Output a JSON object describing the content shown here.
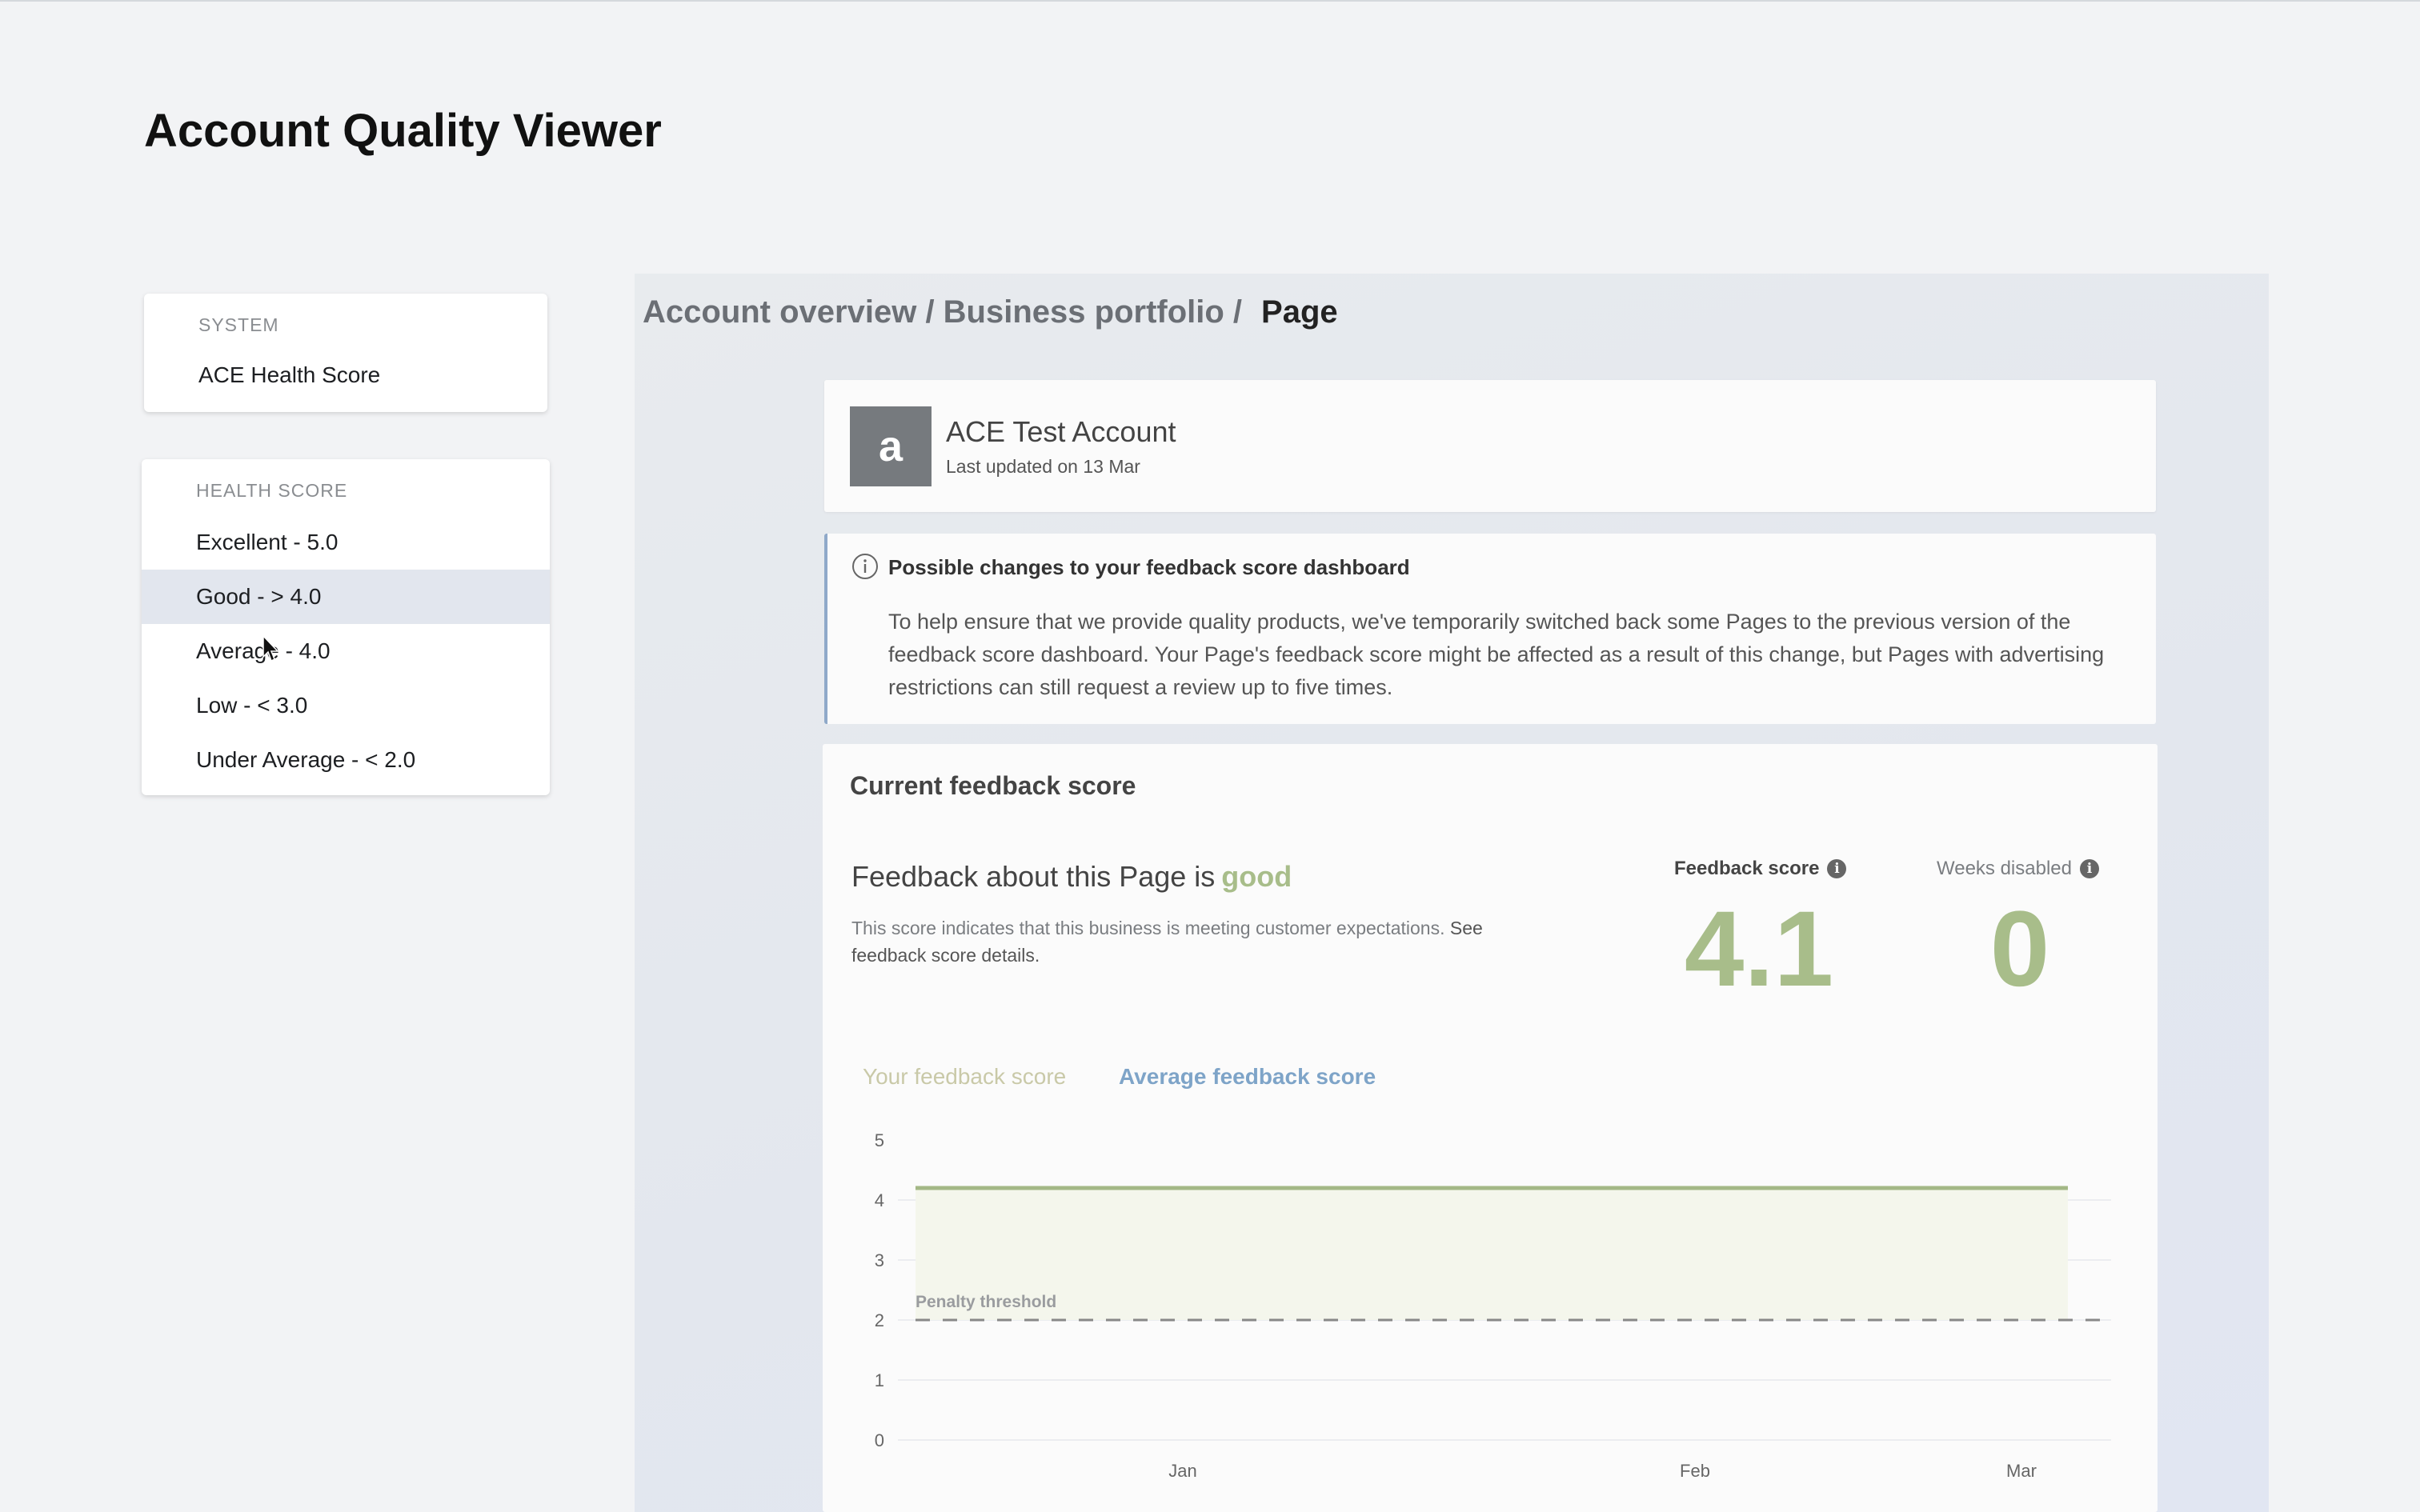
{
  "app": {
    "title": "Account Quality Viewer"
  },
  "system_card": {
    "header": "SYSTEM",
    "item": "ACE Health Score"
  },
  "health_score_card": {
    "header": "HEALTH SCORE",
    "items": [
      {
        "label": "Excellent - 5.0"
      },
      {
        "label": "Good - > 4.0",
        "selected": true
      },
      {
        "label": "Average - 4.0"
      },
      {
        "label": "Low - < 3.0"
      },
      {
        "label": "Under Average - < 2.0"
      }
    ]
  },
  "breadcrumb": {
    "path": "Account overview / Business portfolio /",
    "current": "Page"
  },
  "account": {
    "avatar_letter": "a",
    "name": "ACE Test Account",
    "updated": "Last updated on 13 Mar"
  },
  "notice": {
    "icon": "info-circle-icon",
    "title": "Possible changes to your feedback score dashboard",
    "body": "To help ensure that we provide quality products, we've temporarily switched back some Pages to the previous version of the feedback score dashboard. Your Page's feedback score might be affected as a result of this change, but Pages with advertising restrictions can still request a review up to five times."
  },
  "score": {
    "title": "Current feedback score",
    "headline_prefix": "Feedback about this Page is",
    "headline_status": "good",
    "description": "This score indicates that this business is meeting customer expectations.",
    "details_link": "See feedback score details.",
    "feedback_score_label": "Feedback score",
    "feedback_score_value": "4.1",
    "weeks_disabled_label": "Weeks disabled",
    "weeks_disabled_value": "0",
    "tab_yours": "Your feedback score",
    "tab_average": "Average feedback score"
  },
  "colors": {
    "good": "#a8bd8a",
    "line": "#a3b886",
    "avg_tab": "#7ea4c8",
    "selected_row": "#e2e6ee"
  },
  "chart_data": {
    "type": "line",
    "y_ticks": [
      "5",
      "4",
      "3",
      "2",
      "1",
      "0"
    ],
    "ylim": [
      0,
      5
    ],
    "x_ticks": [
      "Jan",
      "Feb",
      "Mar"
    ],
    "series": [
      {
        "name": "Your feedback score",
        "values": [
          4.2,
          4.2,
          4.2
        ]
      }
    ],
    "threshold": {
      "label": "Penalty threshold",
      "value": 2
    }
  }
}
